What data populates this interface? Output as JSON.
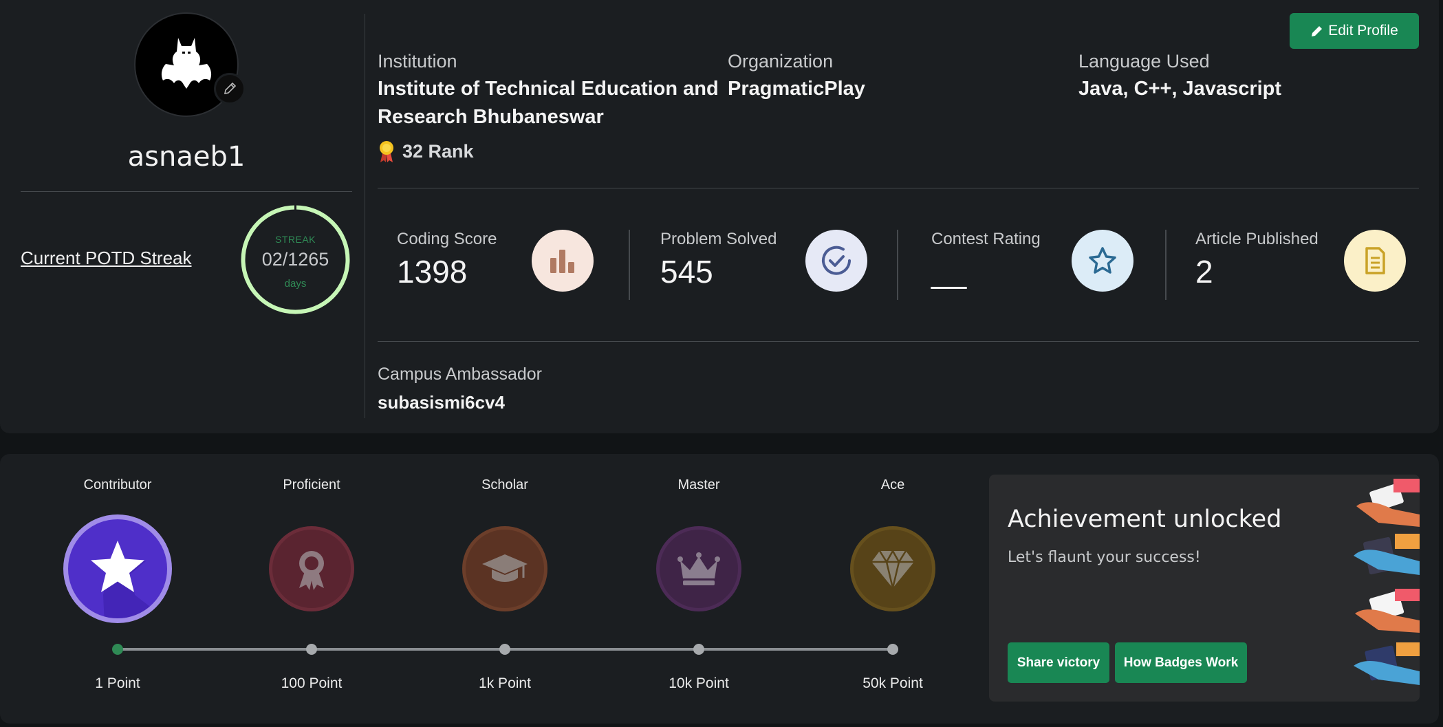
{
  "profile": {
    "username": "asnaeb1",
    "edit_profile_label": "Edit Profile",
    "streak": {
      "link_label": "Current POTD Streak",
      "title": "STREAK",
      "count": "02/1265",
      "unit": "days"
    },
    "institution": {
      "label": "Institution",
      "line1": "Institute of Technical Education and",
      "line2": "Research Bhubaneswar"
    },
    "organization": {
      "label": "Organization",
      "value": "PragmaticPlay"
    },
    "language": {
      "label": "Language Used",
      "value": "Java, C++, Javascript"
    },
    "rank": "32 Rank",
    "stats": [
      {
        "label": "Coding Score",
        "value": "1398",
        "icon": "bar-chart-icon",
        "color": "#b07a62",
        "bg": "#f7e6de"
      },
      {
        "label": "Problem Solved",
        "value": "545",
        "icon": "check-circle-icon",
        "color": "#4b5c94",
        "bg": "#e6e9f6"
      },
      {
        "label": "Contest Rating",
        "value": "__",
        "icon": "star-icon",
        "color": "#2b6a93",
        "bg": "#dcecf7"
      },
      {
        "label": "Article Published",
        "value": "2",
        "icon": "document-icon",
        "color": "#c9a227",
        "bg": "#fbf0c8"
      }
    ],
    "ambassador": {
      "label": "Campus Ambassador",
      "value": "subasismi6cv4"
    }
  },
  "badges": {
    "items": [
      {
        "name": "Contributor",
        "points": "1 Point",
        "icon": "star-icon",
        "color": "#4f2fc9",
        "achieved": true
      },
      {
        "name": "Proficient",
        "points": "100 Point",
        "icon": "award-ribbon-icon",
        "color": "#5a2430",
        "achieved": false
      },
      {
        "name": "Scholar",
        "points": "1k Point",
        "icon": "graduation-cap-icon",
        "color": "#5b3323",
        "achieved": false
      },
      {
        "name": "Master",
        "points": "10k Point",
        "icon": "crown-icon",
        "color": "#3f2447",
        "achieved": false
      },
      {
        "name": "Ace",
        "points": "50k Point",
        "icon": "diamond-icon",
        "color": "#574318",
        "achieved": false
      }
    ],
    "progress_fraction": 0.0
  },
  "achievement": {
    "title": "Achievement unlocked",
    "subtitle": "Let's flaunt your success!",
    "share_label": "Share victory",
    "how_label": "How Badges Work"
  },
  "colors": {
    "accent_green": "#198754",
    "background": "#1b1e21",
    "streak_ring": "#c6f6b6"
  }
}
